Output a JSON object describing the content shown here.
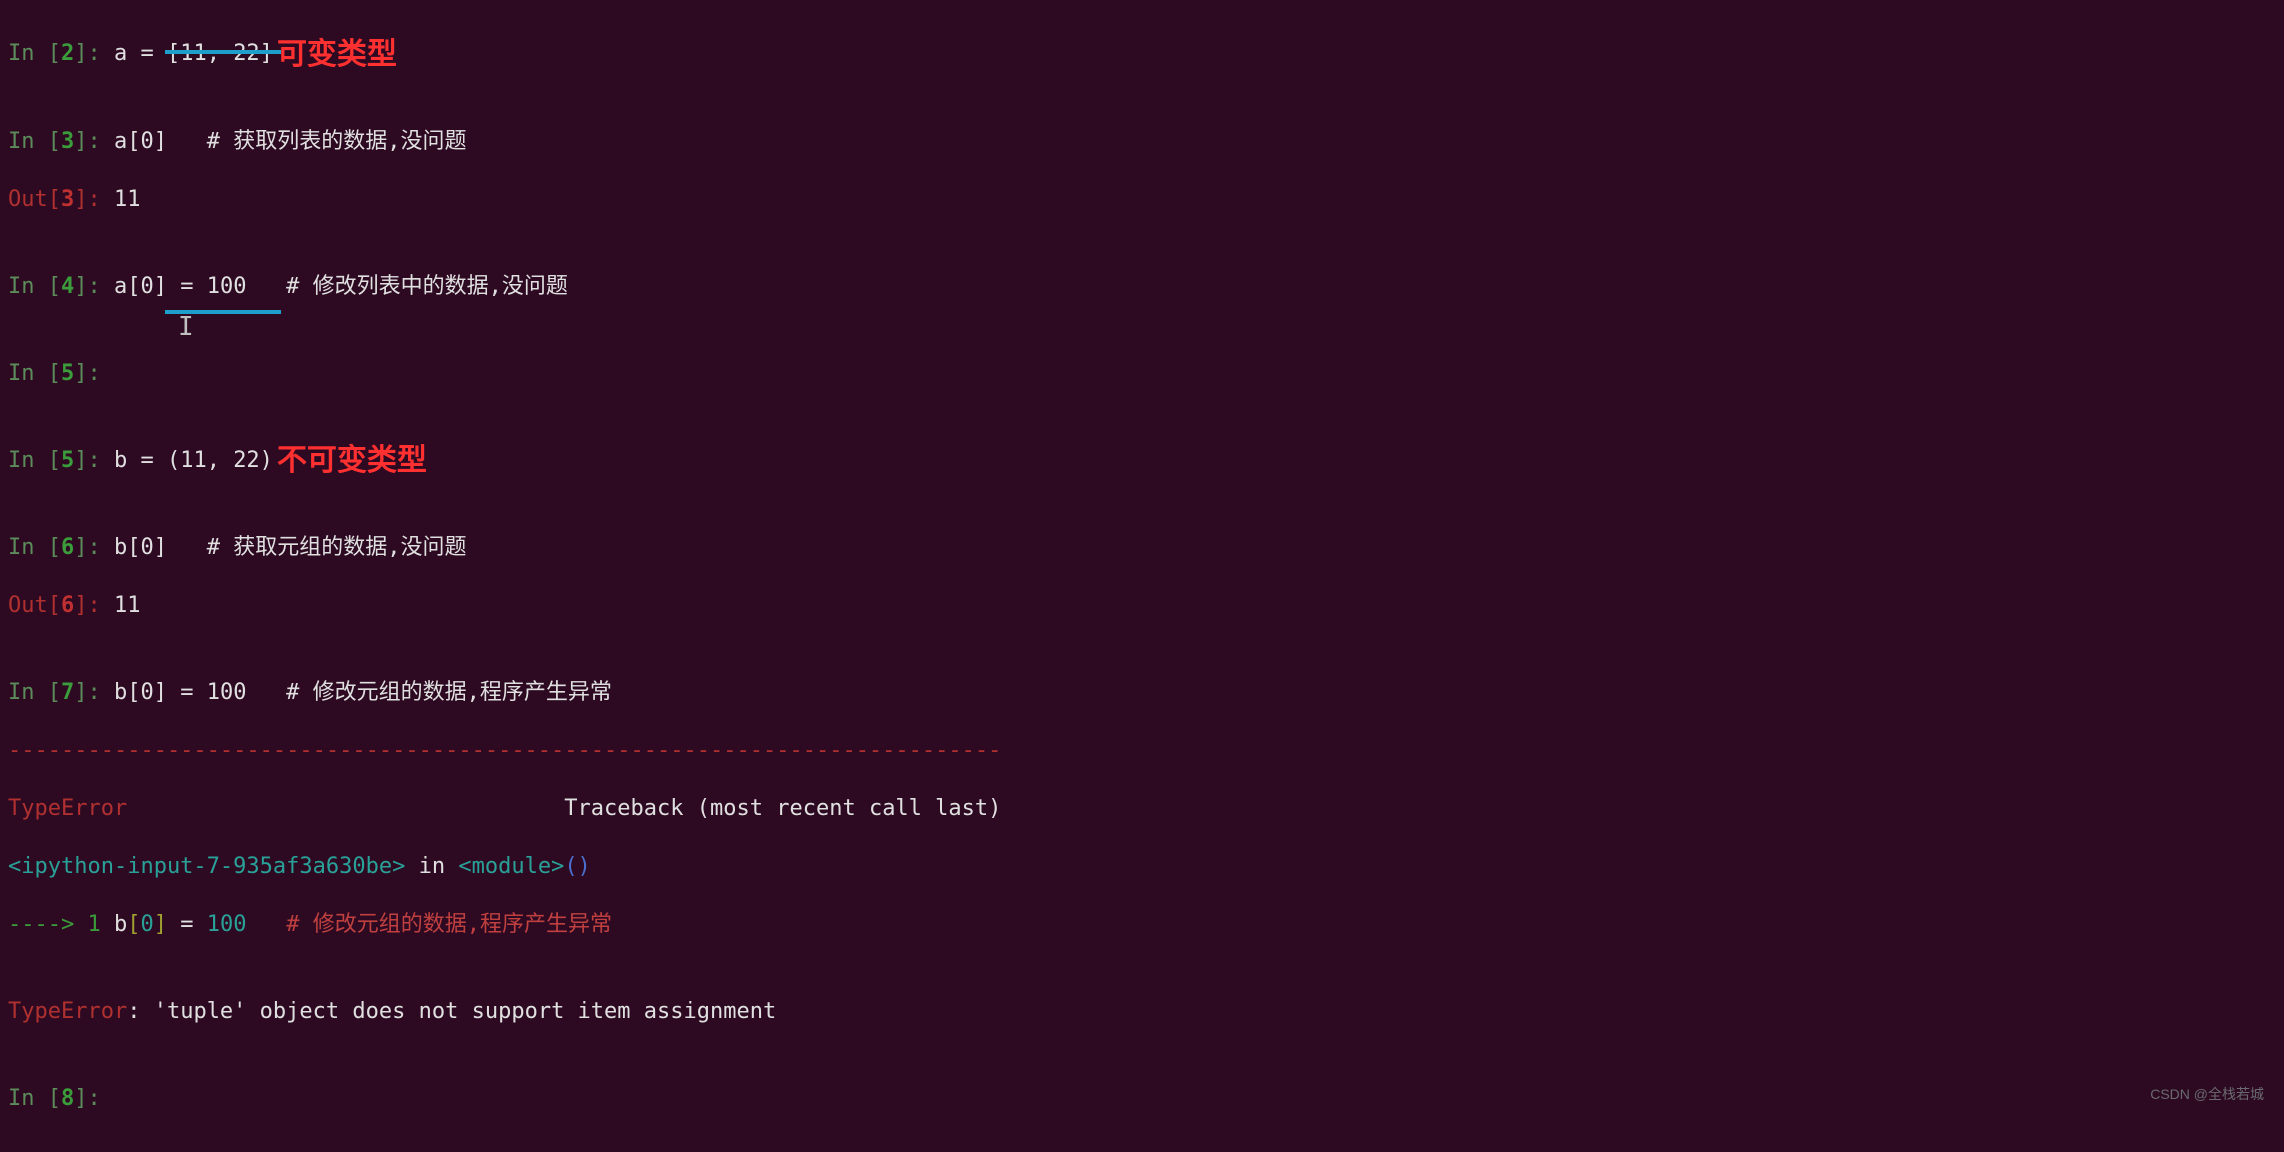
{
  "cells": {
    "c2": {
      "prompt": "In [",
      "n": "2",
      "close": "]: ",
      "code": "a = [11, 22]",
      "annot": "可变类型"
    },
    "c3": {
      "prompt": "In [",
      "n": "3",
      "close": "]: ",
      "code": "a[0]   ",
      "comment": "# 获取列表的数据,没问题"
    },
    "o3": {
      "prompt": "Out[",
      "n": "3",
      "close": "]: ",
      "value": "11"
    },
    "c4": {
      "prompt": "In [",
      "n": "4",
      "close": "]: ",
      "code": "a[0] = 100   ",
      "comment": "# 修改列表中的数据,没问题"
    },
    "c5a": {
      "prompt": "In [",
      "n": "5",
      "close": "]: ",
      "code": ""
    },
    "c5b": {
      "prompt": "In [",
      "n": "5",
      "close": "]: ",
      "code": "b = (11, 22)",
      "annot": "不可变类型"
    },
    "c6": {
      "prompt": "In [",
      "n": "6",
      "close": "]: ",
      "code": "b[0]   ",
      "comment": "# 获取元组的数据,没问题"
    },
    "o6": {
      "prompt": "Out[",
      "n": "6",
      "close": "]: ",
      "value": "11"
    },
    "c7": {
      "prompt": "In [",
      "n": "7",
      "close": "]: ",
      "code": "b[0] = 100   ",
      "comment": "# 修改元组的数据,程序产生异常"
    },
    "c8": {
      "prompt": "In [",
      "n": "8",
      "close": "]: ",
      "code": ""
    }
  },
  "error": {
    "dashes": "---------------------------------------------------------------------------",
    "name1": "TypeError",
    "traceback_label": "                                 Traceback (most recent call last)",
    "loc_open": "<ipython-input-7-935af3a630be>",
    "loc_in": " in ",
    "loc_mod": "<module>",
    "loc_paren": "()",
    "arrow": "----> ",
    "lineno": "1",
    "line_code_a": " b",
    "line_code_b": "[",
    "line_code_c": "0",
    "line_code_d": "]",
    "line_code_e": " = ",
    "line_code_f": "100",
    "line_comment": "   # 修改元组的数据,程序产生异常",
    "name2": "TypeError",
    "msg": ": 'tuple' object does not support item assignment"
  },
  "watermark": "CSDN @全栈若城"
}
